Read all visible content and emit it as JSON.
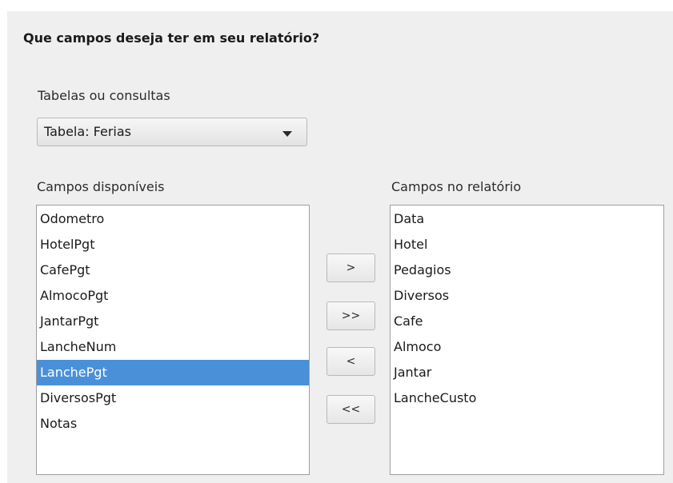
{
  "dialog": {
    "heading": "Que campos deseja ter em seu relatório?"
  },
  "tables": {
    "label": "Tabelas ou consultas",
    "selected": "Tabela: Ferias"
  },
  "available": {
    "label": "Campos disponíveis",
    "items": [
      "Odometro",
      "HotelPgt",
      "CafePgt",
      "AlmocoPgt",
      "JantarPgt",
      "LancheNum",
      "LanchePgt",
      "DiversosPgt",
      "Notas"
    ],
    "selected_index": 6
  },
  "report": {
    "label": "Campos no relatório",
    "items": [
      "Data",
      "Hotel",
      "Pedagios",
      "Diversos",
      "Cafe",
      "Almoco",
      "Jantar",
      "LancheCusto"
    ]
  },
  "buttons": {
    "add": ">",
    "add_all": ">>",
    "remove": "<",
    "remove_all": "<<"
  },
  "colors": {
    "selection": "#4a90d9",
    "panel": "#efefef"
  }
}
